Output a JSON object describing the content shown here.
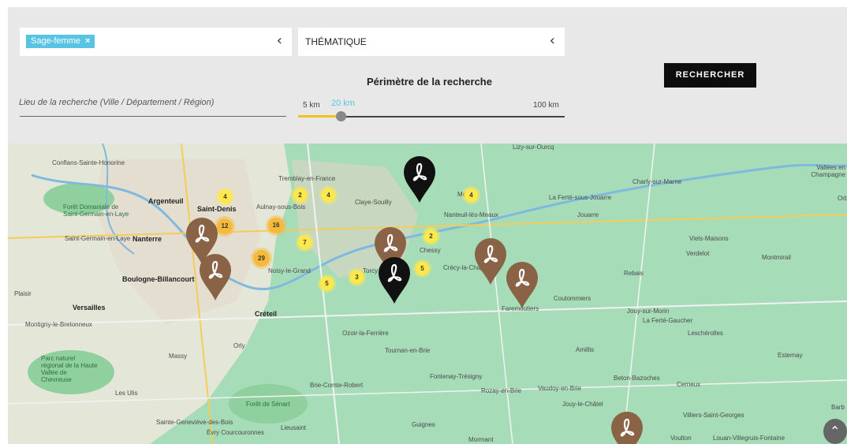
{
  "filters": {
    "profession_tag": "Sage-femme",
    "tag_remove": "×",
    "theme_label": "THÉMATIQUE",
    "chevron": "‹"
  },
  "location": {
    "placeholder": "Lieu de la recherche (Ville / Département / Région)"
  },
  "range": {
    "title": "Périmètre de la recherche",
    "min": "5 km",
    "value": "20 km",
    "max": "100 km",
    "level_fraction": 0.16
  },
  "search_button": "RECHERCHER",
  "map": {
    "places": [
      "Conflans-Sainte-Honorine",
      "Argenteuil",
      "Saint-Denis",
      "Aulnay-sous-Bois",
      "Tremblay-en-France",
      "Claye-Souilly",
      "Nanteuil-lès-Meaux",
      "Meaux",
      "La Ferté-sous-Jouarre",
      "Jouarre",
      "Charly-sur-Marne",
      "Vallées en Champagne",
      "Forêt Domaniale de Saint-Germain-en-Laye",
      "Saint-Germain-en-Laye",
      "Nanterre",
      "Boulogne-Billancourt",
      "Versailles",
      "Montigny-le-Bretonneux",
      "Créteil",
      "Noisy-le-Grand",
      "Torcy",
      "Chessy",
      "Crécy-la-Chapelle",
      "Coulommiers",
      "Faremoutiers",
      "Rebais",
      "Verdelot",
      "Viels-Maisons",
      "Montmirail",
      "Ozoir-la-Ferrière",
      "Tournan-en-Brie",
      "Fontenay-Trésigny",
      "Rozay-en-Brie",
      "Vaudoy-en-Brie",
      "Jouy-le-Châtel",
      "Amillis",
      "Jouy-sur-Morin",
      "La Ferté-Gaucher",
      "Leschérolles",
      "Beton-Bazoches",
      "Cerneux",
      "Esternay",
      "Orly",
      "Massy",
      "Parc naturel régional de la Haute Vallée de Chevreuse",
      "Les Ulis",
      "Brie-Comte-Robert",
      "Forêt de Sénart",
      "Sainte-Geneviève-des-Bois",
      "Évry Courcouronnes",
      "Lieusaint",
      "Guignes",
      "Mormant",
      "Villiers-Saint-Georges",
      "Voulton",
      "Louan-Villegruis-Fontaine",
      "Lizy-sur-Ourcq",
      "Plaisir",
      "Barb",
      "Orb"
    ],
    "clusters": [
      "4",
      "2",
      "4",
      "4",
      "12",
      "16",
      "7",
      "29",
      "2",
      "5",
      "5",
      "3"
    ],
    "pins": {
      "black": "practitioner-pin-black",
      "brown": "practitioner-pin-brown"
    }
  },
  "colors": {
    "panel_bg": "#e8e8e8",
    "tag_bg": "#58c3e3",
    "button_bg": "#0d0d0d",
    "slider_fill": "#f2c318",
    "map_land": "#a7dcb9",
    "pin_brown": "#8a6347",
    "pin_black": "#111111",
    "cluster_yellow": "#ffe84a",
    "cluster_orange": "#f6ba3b"
  },
  "icons": {
    "scroll_top": "chevron-up-icon",
    "pin_symbol": "acrobat-logo"
  }
}
